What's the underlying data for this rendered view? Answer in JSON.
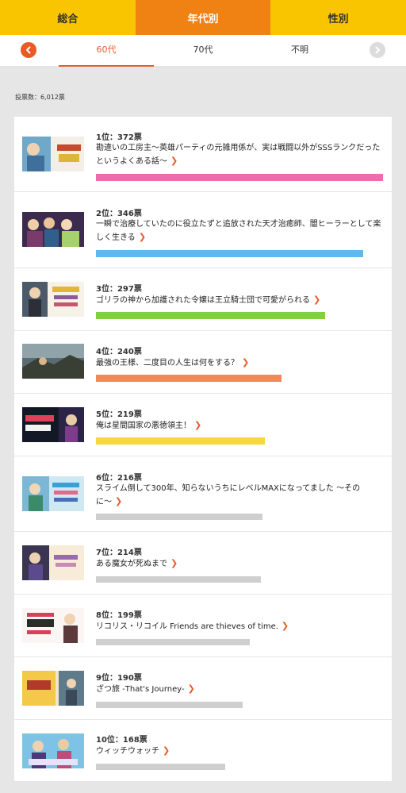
{
  "tabs": [
    {
      "label": "総合"
    },
    {
      "label": "年代別"
    },
    {
      "label": "性別"
    }
  ],
  "subtabs": [
    {
      "label": "60代"
    },
    {
      "label": "70代"
    },
    {
      "label": "不明"
    }
  ],
  "vote_count": "投票数：6,012票",
  "colors": {
    "tab_bar": "#f9c400",
    "tab_active": "#f08113",
    "accent": "#e95a25",
    "bar_pink": "#f06aae",
    "bar_blue": "#61b8ec",
    "bar_green": "#7fd23c",
    "bar_orange": "#f5875b",
    "bar_yellow": "#f7d73a",
    "bar_gray": "#cfcfcf"
  },
  "rankings": [
    {
      "rank_label": "1位：372票",
      "title": "勘違いの工房主〜英雄パーティの元雑用係が、実は戦闘以外がSSSランクだったというよくある話〜",
      "votes": 372,
      "bar_color": "#f06aae"
    },
    {
      "rank_label": "2位：346票",
      "title": "一瞬で治療していたのに役立たずと追放された天才治癒師、闇ヒーラーとして楽しく生きる",
      "votes": 346,
      "bar_color": "#61b8ec"
    },
    {
      "rank_label": "3位：297票",
      "title": "ゴリラの神から加護された令嬢は王立騎士団で可愛がられる",
      "votes": 297,
      "bar_color": "#7fd23c"
    },
    {
      "rank_label": "4位：240票",
      "title": "最強の王様、二度目の人生は何をする？",
      "votes": 240,
      "bar_color": "#f5875b"
    },
    {
      "rank_label": "5位：219票",
      "title": "俺は星間国家の悪徳領主！",
      "votes": 219,
      "bar_color": "#f7d73a"
    },
    {
      "rank_label": "6位：216票",
      "title": "スライム倒して300年、知らないうちにレベルMAXになってました 〜そのに〜",
      "votes": 216,
      "bar_color": "#cfcfcf"
    },
    {
      "rank_label": "7位：214票",
      "title": "ある魔女が死ぬまで",
      "votes": 214,
      "bar_color": "#cfcfcf"
    },
    {
      "rank_label": "8位：199票",
      "title": "リコリス・リコイル Friends are thieves of time.",
      "votes": 199,
      "bar_color": "#cfcfcf"
    },
    {
      "rank_label": "9位：190票",
      "title": "ざつ旅 -That's Journey-",
      "votes": 190,
      "bar_color": "#cfcfcf"
    },
    {
      "rank_label": "10位：168票",
      "title": "ウィッチウォッチ",
      "votes": 168,
      "bar_color": "#cfcfcf"
    }
  ]
}
